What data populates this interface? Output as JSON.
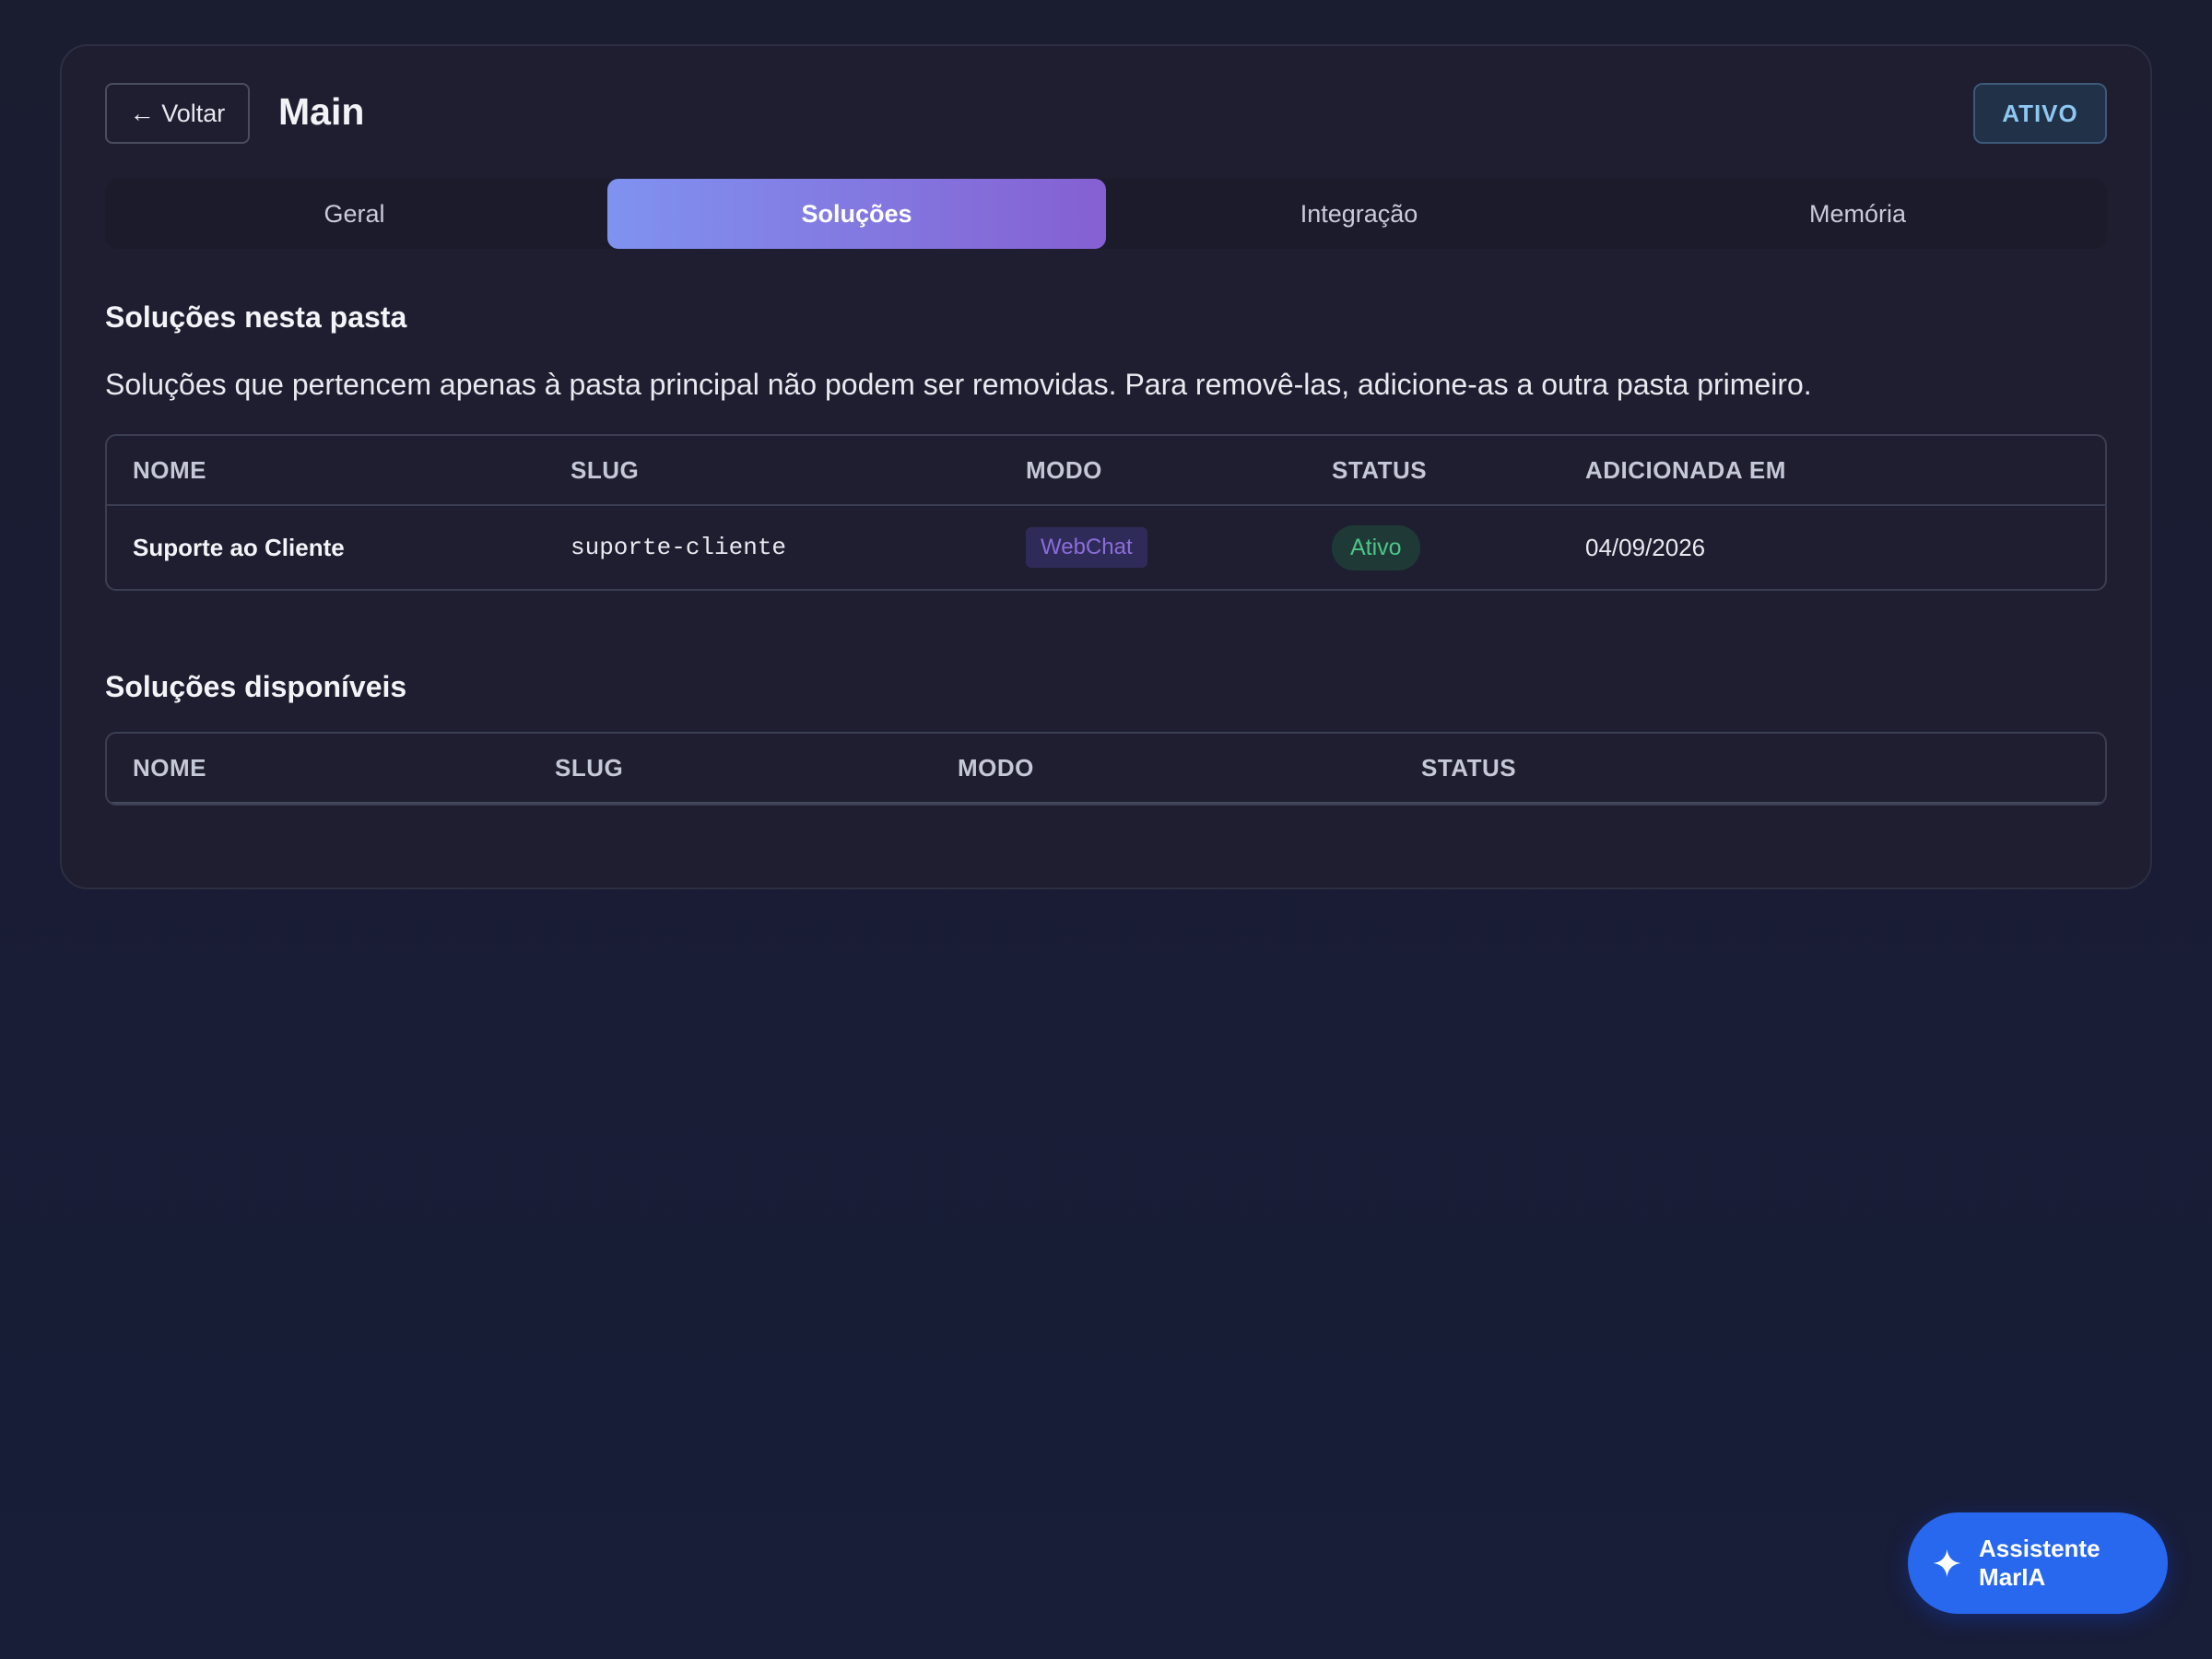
{
  "header": {
    "back_label": "← Voltar",
    "title": "Main",
    "status": "ATIVO"
  },
  "tabs": [
    {
      "label": "Geral",
      "active": false
    },
    {
      "label": "Soluções",
      "active": true
    },
    {
      "label": "Integração",
      "active": false
    },
    {
      "label": "Memória",
      "active": false
    }
  ],
  "section_in_folder": {
    "title": "Soluções nesta pasta",
    "info": "Soluções que pertencem apenas à pasta principal não podem ser removidas. Para removê-las, adicione-as a outra pasta primeiro.",
    "columns": [
      "NOME",
      "SLUG",
      "MODO",
      "STATUS",
      "ADICIONADA EM"
    ],
    "rows": [
      {
        "name": "Suporte ao Cliente",
        "slug": "suporte-cliente",
        "mode": "WebChat",
        "status": "Ativo",
        "added": "04/09/2026"
      }
    ]
  },
  "section_available": {
    "title": "Soluções disponíveis",
    "columns": [
      "NOME",
      "SLUG",
      "MODO",
      "STATUS"
    ]
  },
  "fab": {
    "label": "Assistente MarIA",
    "icon": "sparkle-icon"
  },
  "colors": {
    "accent_gradient_start": "#8092f0",
    "accent_gradient_end": "#8560d2",
    "fab": "#2868ee",
    "status_active": "#4cc589",
    "mode_badge": "#8a6ddb"
  }
}
